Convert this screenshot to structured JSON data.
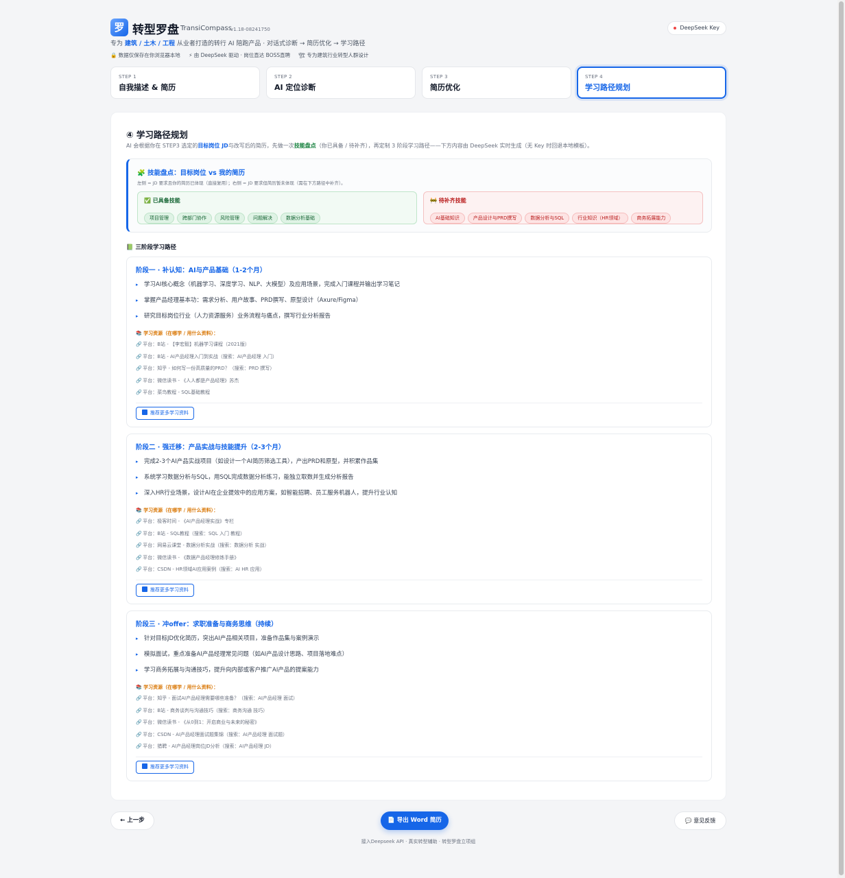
{
  "app": {
    "logo_char": "罗",
    "title": "转型罗盘",
    "subtitle_en": "TransiCompass",
    "version": "v1.18-08241750",
    "tagline_pre": "专为",
    "tagline_hl": "建筑 / 土木 / 工程",
    "tagline_post": "从业者打造的转行 AI 陪跑产品 · 对话式诊断 → 简历优化 → 学习路径",
    "badge_1": "🔒 数据仅保存在你浏览器本地",
    "badge_2": "⚡ 由 DeepSeek 驱动 · 岗位直达 BOSS直聘",
    "badge_3": "🏗 专为建筑行业转型人群设计",
    "key_button": "DeepSeek Key"
  },
  "steps": [
    {
      "no": "STEP 1",
      "name": "自我描述 & 简历"
    },
    {
      "no": "STEP 2",
      "name": "AI 定位诊断"
    },
    {
      "no": "STEP 3",
      "name": "简历优化"
    },
    {
      "no": "STEP 4",
      "name": "学习路径规划"
    }
  ],
  "main": {
    "title": "④ 学习路径规划",
    "desc_1": "AI 会根据你在 STEP3 选定的",
    "desc_hl1": "目标岗位 JD",
    "desc_2": "与改写后的简历，先做一次",
    "desc_hl2": "技能盘点",
    "desc_3": "（你已具备 / 待补齐），再定制 3 阶段学习路径——下方内容由 DeepSeek 实时生成（无 Key 时回退本地模板）。",
    "inventory": {
      "title": "🧩 技能盘点：目标岗位 vs 我的简历",
      "sub": "左侧 = JD 要求且你的简历已体现（直接复用）；右侧 = JD 要求但简历暂未体现（需在下方路径中补齐）。",
      "have_title": "✅ 已具备技能",
      "have": [
        "项目管理",
        "跨部门协作",
        "风险管理",
        "问题解决",
        "数据分析基础"
      ],
      "todo_title": "🚧 待补齐技能",
      "todo": [
        "AI基础知识",
        "产品设计与PRD撰写",
        "数据分析与SQL",
        "行业知识（HR领域）",
        "商务拓展能力"
      ]
    },
    "path_title": "📗 三阶段学习路径",
    "res_head": "📚 学习资源（在哪学 / 用什么资料）：",
    "more_label": "推荐更多学习资料",
    "stages": [
      {
        "title": "阶段一 · 补认知：AI与产品基础（1-2个月）",
        "goals": [
          "学习AI核心概念（机器学习、深度学习、NLP、大模型）及应用场景，完成入门课程并输出学习笔记",
          "掌握产品经理基本功：需求分析、用户故事、PRD撰写、原型设计（Axure/Figma）",
          "研究目标岗位行业（人力资源服务）业务流程与痛点，撰写行业分析报告"
        ],
        "resources": [
          "平台：B站 - 【李宏毅】机器学习课程（2021版）",
          "平台：B站 - AI产品经理入门到实战（搜索：AI产品经理 入门）",
          "平台：知乎 - 如何写一份高质量的PRD？（搜索：PRD 撰写）",
          "平台：微信读书 - 《人人都是产品经理》苏杰",
          "平台：菜鸟教程 - SQL基础教程"
        ]
      },
      {
        "title": "阶段二 · 强迁移：产品实战与技能提升（2-3个月）",
        "goals": [
          "完成2-3个AI产品实战项目（如设计一个AI简历筛选工具），产出PRD和原型，并积累作品集",
          "系统学习数据分析与SQL，用SQL完成数据分析练习，能独立取数并生成分析报告",
          "深入HR行业场景，设计AI在企业提效中的应用方案，如智能招聘、员工服务机器人，提升行业认知"
        ],
        "resources": [
          "平台：极客时间 - 《AI产品经理实战》专栏",
          "平台：B站 - SQL教程（搜索：SQL 入门 教程）",
          "平台：网易云课堂 - 数据分析实战（搜索：数据分析 实战）",
          "平台：微信读书 - 《数据产品经理修炼手册》",
          "平台：CSDN - HR领域AI应用案例（搜索：AI HR 应用）"
        ]
      },
      {
        "title": "阶段三 · 冲offer：求职准备与商务思维（持续）",
        "goals": [
          "针对目标JD优化简历，突出AI产品相关项目，准备作品集与案例演示",
          "模拟面试，重点准备AI产品经理常见问题（如AI产品设计思路、项目落地难点）",
          "学习商务拓展与沟通技巧，提升向内部或客户推广AI产品的提案能力"
        ],
        "resources": [
          "平台：知乎 - 面试AI产品经理需要哪些准备？（搜索：AI产品经理 面试）",
          "平台：B站 - 商务谈判与沟通技巧（搜索：商务沟通 技巧）",
          "平台：微信读书 - 《从0到1：开启商业与未来的秘密》",
          "平台：CSDN - AI产品经理面试题集锦（搜索：AI产品经理 面试题）",
          "平台：猎聘 - AI产品经理岗位JD分析（搜索：AI产品经理 JD）"
        ]
      }
    ]
  },
  "bottom": {
    "prev": "← 上一步",
    "export": "📄 导出 Word 简历",
    "feedback": "💬 意见反馈",
    "footer": "接入Deepseek API · 真实转型辅助 · 转型罗盘立项组"
  }
}
